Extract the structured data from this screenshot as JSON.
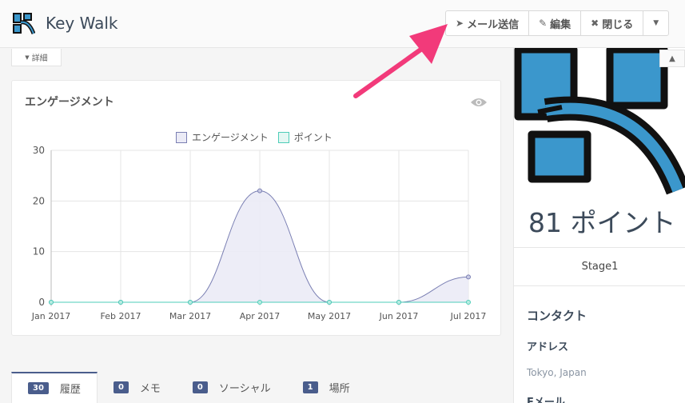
{
  "header": {
    "title": "Key Walk",
    "buttons": [
      {
        "icon": "paper-plane-icon",
        "label": "メール送信"
      },
      {
        "icon": "edit-icon",
        "label": "編集"
      },
      {
        "icon": "close-icon",
        "label": "閉じる"
      },
      {
        "icon": "caret-down-icon",
        "label": ""
      }
    ]
  },
  "details_tab": {
    "label": "詳細"
  },
  "chart_card": {
    "title": "エンゲージメント"
  },
  "chart_data": {
    "type": "line",
    "x": [
      "Jan 2017",
      "Feb 2017",
      "Mar 2017",
      "Apr 2017",
      "May 2017",
      "Jun 2017",
      "Jul 2017"
    ],
    "series": [
      {
        "name": "エンゲージメント",
        "values": [
          0,
          0,
          0,
          22,
          0,
          0,
          5
        ],
        "color": "#7a7fb3",
        "fill": "#ebebf6"
      },
      {
        "name": "ポイント",
        "values": [
          0,
          0,
          0,
          0,
          0,
          0,
          0
        ],
        "color": "#4ecdb8",
        "fill": "#e4f7f3"
      }
    ],
    "yticks": [
      "0",
      "10",
      "20",
      "30"
    ],
    "ylim": [
      0,
      30
    ],
    "grid": true,
    "legend": "top"
  },
  "panel": {
    "points": "81 ポイント",
    "stage": "Stage1",
    "contact_heading": "コンタクト",
    "address_heading": "アドレス",
    "address_value": "Tokyo, Japan",
    "email_heading": "Eメール"
  },
  "tabs": [
    {
      "count": "30",
      "label": "履歴",
      "active": true
    },
    {
      "count": "0",
      "label": "メモ",
      "active": false
    },
    {
      "count": "0",
      "label": "ソーシャル",
      "active": false
    },
    {
      "count": "1",
      "label": "場所",
      "active": false
    }
  ],
  "colors": {
    "accent": "#4a5d8c",
    "logo_blue": "#3b97cc",
    "arrow": "#f23a7a"
  }
}
